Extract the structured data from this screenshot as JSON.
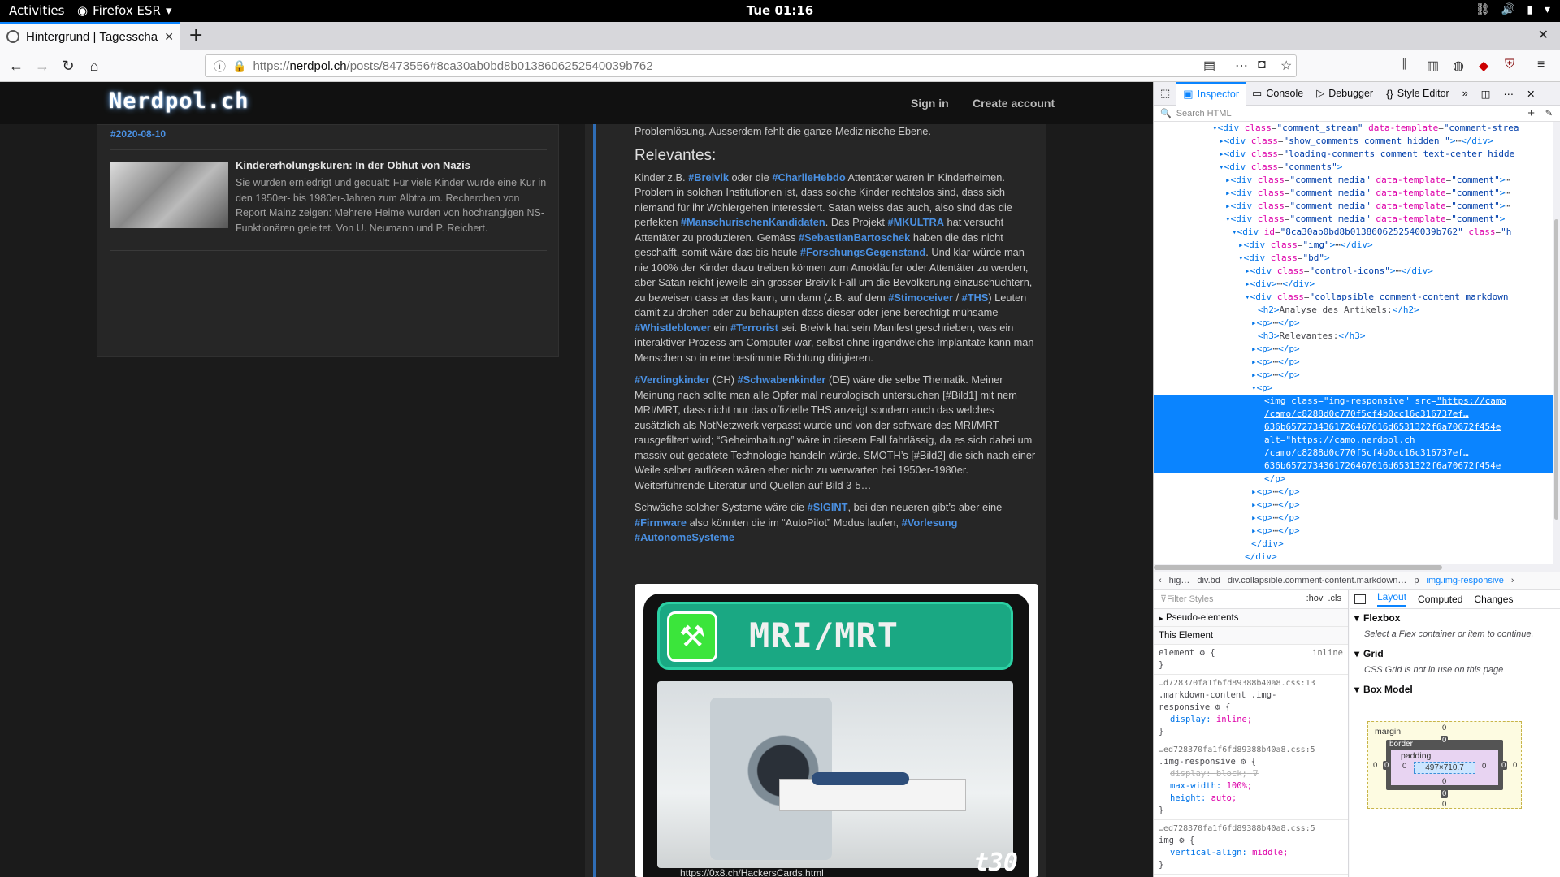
{
  "topbar": {
    "activities": "Activities",
    "app": "Firefox ESR",
    "clock": "Tue 01:16"
  },
  "browser": {
    "tab_title": "Hintergrund | Tagesschau",
    "url_prefix": "https://",
    "url_host": "nerdpol.ch",
    "url_path": "/posts/8473556#8ca30ab0bd8b0138606252540039b762"
  },
  "site": {
    "logo": "Nerdpol.ch",
    "signin": "Sign in",
    "create_account": "Create account"
  },
  "sidebar": {
    "date_tag": "#2020-08-10",
    "article_title": "Kindererholungskuren: In der Obhut von Nazis",
    "article_text": "Sie wurden erniedrigt und gequält: Für viele Kinder wurde eine Kur in den 1950er- bis 1980er-Jahren zum Albtraum. Recherchen von Report Mainz zeigen: Mehrere Heime wurden von hochrangigen NS-Funktionären geleitet. Von U. Neumann und P. Reichert."
  },
  "comment": {
    "intro": "Problemlösung. Ausserdem fehlt die ganze Medizinische Ebene.",
    "heading": "Relevantes:",
    "p1": [
      {
        "t": "Kinder z.B. "
      },
      {
        "tag": "#Breivik"
      },
      {
        "t": " oder die "
      },
      {
        "tag": "#CharlieHebdo"
      },
      {
        "t": " Attentäter waren in Kinderheimen. Problem in solchen Institutionen ist, dass solche Kinder rechtelos sind, dass sich niemand für ihr Wohlergehen interessiert. Satan weiss das auch, also sind das die perfekten "
      },
      {
        "tag": "#ManschurischenKandidaten"
      },
      {
        "t": ". Das Projekt "
      },
      {
        "tag": "#MKULTRA"
      },
      {
        "t": " hat versucht Attentäter zu produzieren. Gemäss "
      },
      {
        "tag": "#SebastianBartoschek"
      },
      {
        "t": " haben die das nicht geschafft, somit wäre das bis heute "
      },
      {
        "tag": "#ForschungsGegenstand"
      },
      {
        "t": ". Und klar würde man nie 100% der Kinder dazu treiben können zum Amokläufer oder Attentäter zu werden, aber Satan reicht jeweils ein grosser Breivik Fall um die Bevölkerung einzuschüchtern, zu beweisen dass er das kann, um dann (z.B. auf dem "
      },
      {
        "tag": "#Stimoceiver"
      },
      {
        "t": " / "
      },
      {
        "tag": "#THS"
      },
      {
        "t": ") Leuten damit zu drohen oder zu behaupten dass dieser oder jene berechtigt mühsame "
      },
      {
        "tag": "#Whistleblower"
      },
      {
        "t": " ein "
      },
      {
        "tag": "#Terrorist"
      },
      {
        "t": " sei. Breivik hat sein Manifest geschrieben, was ein interaktiver Prozess am Computer war, selbst ohne irgendwelche Implantate kann man Menschen so in eine bestimmte Richtung dirigieren."
      }
    ],
    "p2": [
      {
        "tag": "#Verdingkinder"
      },
      {
        "t": " (CH) "
      },
      {
        "tag": "#Schwabenkinder"
      },
      {
        "t": " (DE) wäre die selbe Thematik. Meiner Meinung nach sollte man alle Opfer mal neurologisch untersuchen [#Bild1] mit nem MRI/MRT, dass nicht nur das offizielle THS anzeigt sondern auch das welches zusätzlich als NotNetzwerk verpasst wurde und von der software des MRI/MRT rausgefiltert wird; “Geheimhaltung” wäre in diesem Fall fahrlässig, da es sich dabei um massiv out-gedatete Technologie handeln würde. SMOTH’s [#Bild2] die sich nach einer Weile selber auflösen wären eher nicht zu werwarten bei 1950er-1980er. Weiterführende Literatur und Quellen auf Bild 3-5…"
      }
    ],
    "p3": [
      {
        "t": "Schwäche solcher Systeme wäre die "
      },
      {
        "tag": "#SIGINT"
      },
      {
        "t": ", bei den neueren gibt’s aber eine "
      },
      {
        "tag": "#Firmware"
      },
      {
        "t": " also könnten die im “AutoPilot” Modus laufen, "
      },
      {
        "tag": "#Vorlesung"
      },
      {
        "t": " "
      },
      {
        "tag": "#AutonomeSysteme"
      }
    ],
    "image_title": "MRI/MRT",
    "image_corner": "t30",
    "image_caption": "https://0x8.ch/HackersCards.html"
  },
  "devtools": {
    "tabs": [
      {
        "label": "Inspector",
        "icon": "inspector-icon"
      },
      {
        "label": "Console",
        "icon": "console-icon"
      },
      {
        "label": "Debugger",
        "icon": "debugger-icon"
      },
      {
        "label": "Style Editor",
        "icon": "style-editor-icon"
      }
    ],
    "search_placeholder": "Search HTML",
    "tree": [
      {
        "indent": 9,
        "html": "<span class='tg'>▾&lt;div</span> <span class='at'>class</span>=<span class='av'>\"comment_stream\"</span> <span class='at'>data-template</span>=<span class='av'>\"comment-strea</span>"
      },
      {
        "indent": 10,
        "html": "<span class='tg'>▸&lt;div</span> <span class='at'>class</span>=<span class='av'>\"show_comments comment hidden \"</span><span class='tg'>&gt;</span>⋯<span class='tg'>&lt;/div&gt;</span>"
      },
      {
        "indent": 10,
        "html": "<span class='tg'>▸&lt;div</span> <span class='at'>class</span>=<span class='av'>\"loading-comments comment text-center hidde</span>"
      },
      {
        "indent": 10,
        "html": "<span class='tg'>▾&lt;div</span> <span class='at'>class</span>=<span class='av'>\"comments\"</span><span class='tg'>&gt;</span>"
      },
      {
        "indent": 11,
        "html": "<span class='tg'>▸&lt;div</span> <span class='at'>class</span>=<span class='av'>\"comment media\"</span> <span class='at'>data-template</span>=<span class='av'>\"comment\"</span><span class='tg'>&gt;</span>⋯"
      },
      {
        "indent": 11,
        "html": "<span class='tg'>▸&lt;div</span> <span class='at'>class</span>=<span class='av'>\"comment media\"</span> <span class='at'>data-template</span>=<span class='av'>\"comment\"</span><span class='tg'>&gt;</span>⋯"
      },
      {
        "indent": 11,
        "html": "<span class='tg'>▸&lt;div</span> <span class='at'>class</span>=<span class='av'>\"comment media\"</span> <span class='at'>data-template</span>=<span class='av'>\"comment\"</span><span class='tg'>&gt;</span>⋯"
      },
      {
        "indent": 11,
        "html": "<span class='tg'>▾&lt;div</span> <span class='at'>class</span>=<span class='av'>\"comment media\"</span> <span class='at'>data-template</span>=<span class='av'>\"comment\"</span><span class='tg'>&gt;</span>"
      },
      {
        "indent": 12,
        "html": "<span class='tg'>▾&lt;div</span> <span class='at'>id</span>=<span class='av'>\"8ca30ab0bd8b0138606252540039b762\"</span> <span class='at'>class</span>=<span class='av'>\"h</span>"
      },
      {
        "indent": 13,
        "html": "<span class='tg'>▸&lt;div</span> <span class='at'>class</span>=<span class='av'>\"img\"</span><span class='tg'>&gt;</span>⋯<span class='tg'>&lt;/div&gt;</span>"
      },
      {
        "indent": 13,
        "html": "<span class='tg'>▾&lt;div</span> <span class='at'>class</span>=<span class='av'>\"bd\"</span><span class='tg'>&gt;</span>"
      },
      {
        "indent": 14,
        "html": "<span class='tg'>▸&lt;div</span> <span class='at'>class</span>=<span class='av'>\"control-icons\"</span><span class='tg'>&gt;</span>⋯<span class='tg'>&lt;/div&gt;</span>"
      },
      {
        "indent": 14,
        "html": "<span class='tg'>▸&lt;div&gt;</span>⋯<span class='tg'>&lt;/div&gt;</span>"
      },
      {
        "indent": 14,
        "html": "<span class='tg'>▾&lt;div</span> <span class='at'>class</span>=<span class='av'>\"collapsible comment-content markdown</span>"
      },
      {
        "indent": 16,
        "html": "<span class='tg'>&lt;h2&gt;</span>Analyse des Artikels:<span class='tg'>&lt;/h2&gt;</span>"
      },
      {
        "indent": 15,
        "html": "<span class='tg'>▸&lt;p&gt;</span>⋯<span class='tg'>&lt;/p&gt;</span>"
      },
      {
        "indent": 16,
        "html": "<span class='tg'>&lt;h3&gt;</span>Relevantes:<span class='tg'>&lt;/h3&gt;</span>"
      },
      {
        "indent": 15,
        "html": "<span class='tg'>▸&lt;p&gt;</span>⋯<span class='tg'>&lt;/p&gt;</span>"
      },
      {
        "indent": 15,
        "html": "<span class='tg'>▸&lt;p&gt;</span>⋯<span class='tg'>&lt;/p&gt;</span>"
      },
      {
        "indent": 15,
        "html": "<span class='tg'>▸&lt;p&gt;</span>⋯<span class='tg'>&lt;/p&gt;</span>"
      },
      {
        "indent": 15,
        "html": "<span class='tg'>▾&lt;p&gt;</span>"
      },
      {
        "indent": 17,
        "sel": true,
        "html": "<span class='tg'>&lt;img</span> <span class='at'>class</span>=<span class='av'>\"img-responsive\"</span> <span class='at'>src</span>=<span class='av lk'>\"https://camo</span>"
      },
      {
        "indent": 17,
        "sel": true,
        "html": "<span class='lk'>/camo/c8288d0c770f5cf4b0cc16c316737ef…</span>"
      },
      {
        "indent": 17,
        "sel": true,
        "html": "<span class='lk'>636b6572734361726467616d6531322f6a70672f454e</span>"
      },
      {
        "indent": 17,
        "sel": true,
        "html": "<span class='at'>alt</span>=<span class='av'>\"https://camo.nerdpol.ch</span>"
      },
      {
        "indent": 17,
        "sel": true,
        "html": "/camo/c8288d0c770f5cf4b0cc16c316737ef…"
      },
      {
        "indent": 17,
        "sel": true,
        "html": "636b6572734361726467616d6531322f6a70672f454e"
      },
      {
        "indent": 17,
        "html": "<span class='tg'>&lt;/p&gt;</span>"
      },
      {
        "indent": 15,
        "html": "<span class='tg'>▸&lt;p&gt;</span>⋯<span class='tg'>&lt;/p&gt;</span>"
      },
      {
        "indent": 15,
        "html": "<span class='tg'>▸&lt;p&gt;</span>⋯<span class='tg'>&lt;/p&gt;</span>"
      },
      {
        "indent": 15,
        "html": "<span class='tg'>▸&lt;p&gt;</span>⋯<span class='tg'>&lt;/p&gt;</span>"
      },
      {
        "indent": 15,
        "html": "<span class='tg'>▸&lt;p&gt;</span>⋯<span class='tg'>&lt;/p&gt;</span>"
      },
      {
        "indent": 15,
        "html": "<span class='tg'>&lt;/div&gt;</span>"
      },
      {
        "indent": 14,
        "html": "<span class='tg'>&lt;/div&gt;</span>"
      },
      {
        "indent": 13,
        "html": "<span class='tg'>&lt;/div&gt;</span>"
      }
    ],
    "breadcrumb": [
      "hig…",
      "div.bd",
      "div.collapsible.comment-content.markdown…",
      "p",
      "img.img-responsive"
    ],
    "rules": {
      "filter_placeholder": "Filter Styles",
      "hov": ":hov",
      "cls": ".cls",
      "pseudo": "Pseudo-elements",
      "this_element": "This Element",
      "element_rule": "element",
      "element_inline": "inline",
      "r1_src": "…d728370fa1f6fd89388b40a8.css:13",
      "r1_sel1": ".markdown-content .img-",
      "r1_sel2": "responsive",
      "r1_prop": "display",
      "r1_val": "inline;",
      "r2_src": "…ed728370fa1f6fd89388b40a8.css:5",
      "r2_sel": ".img-responsive",
      "r2_p1": "display",
      "r2_v1": "block;",
      "r2_p2": "max-width",
      "r2_v2": "100%;",
      "r2_p3": "height",
      "r2_v3": "auto;",
      "r3_src": "…ed728370fa1f6fd89388b40a8.css:5",
      "r3_sel": "img",
      "r3_p1": "vertical-align",
      "r3_v1": "middle;"
    },
    "layout": {
      "tabs": [
        "Layout",
        "Computed",
        "Changes"
      ],
      "flexbox": "Flexbox",
      "flexbox_note": "Select a Flex container or item to continue.",
      "grid": "Grid",
      "grid_note": "CSS Grid is not in use on this page",
      "boxmodel": "Box Model",
      "margin_label": "margin",
      "border_label": "border",
      "padding_label": "padding",
      "content_size": "497×710.7",
      "zero": "0"
    }
  }
}
